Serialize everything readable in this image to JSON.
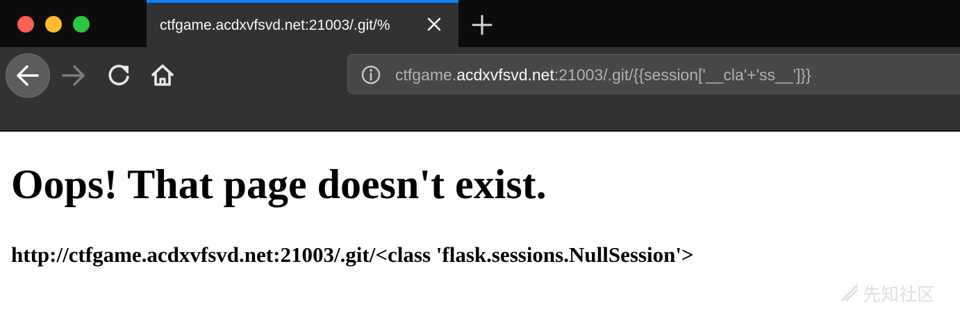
{
  "window": {
    "controls": {
      "close_color": "#fe5f57",
      "minimize_color": "#febc2e",
      "maximize_color": "#28c840"
    }
  },
  "tab": {
    "title": "ctfgame.acdxvfsvd.net:21003/.git/%",
    "close_icon": "close-icon",
    "accent_color": "#0a84ff"
  },
  "toolbar": {
    "new_tab_icon": "plus-icon",
    "back_icon": "arrow-left-icon",
    "forward_icon": "arrow-right-icon",
    "reload_icon": "reload-icon",
    "home_icon": "home-icon"
  },
  "urlbar": {
    "info_icon": "info-icon",
    "url_prefix": "ctfgame.",
    "url_domain": "acdxvfsvd.net",
    "url_suffix": ":21003/.git/{{session['__cla'+'ss__']}}"
  },
  "page": {
    "title": "Oops! That page doesn't exist.",
    "message": "http://ctfgame.acdxvfsvd.net:21003/.git/<class 'flask.sessions.NullSession'>"
  },
  "watermark": {
    "text": "先知社区"
  }
}
